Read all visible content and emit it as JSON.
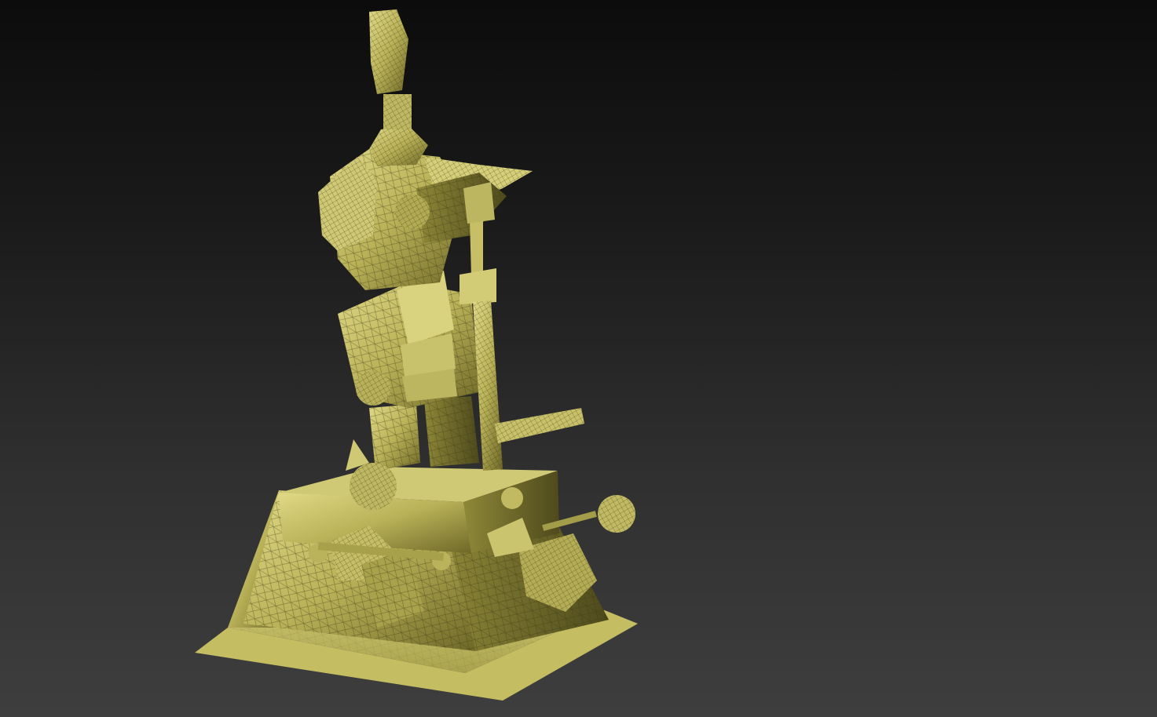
{
  "viewport": {
    "background_top": "#0c0c0c",
    "background_bottom": "#3e3e3e"
  },
  "model": {
    "material_color": "#c9c36a",
    "material_shadow": "#5f5a22",
    "material_highlight": "#e8e29a",
    "wire_color": "#3a3612"
  }
}
